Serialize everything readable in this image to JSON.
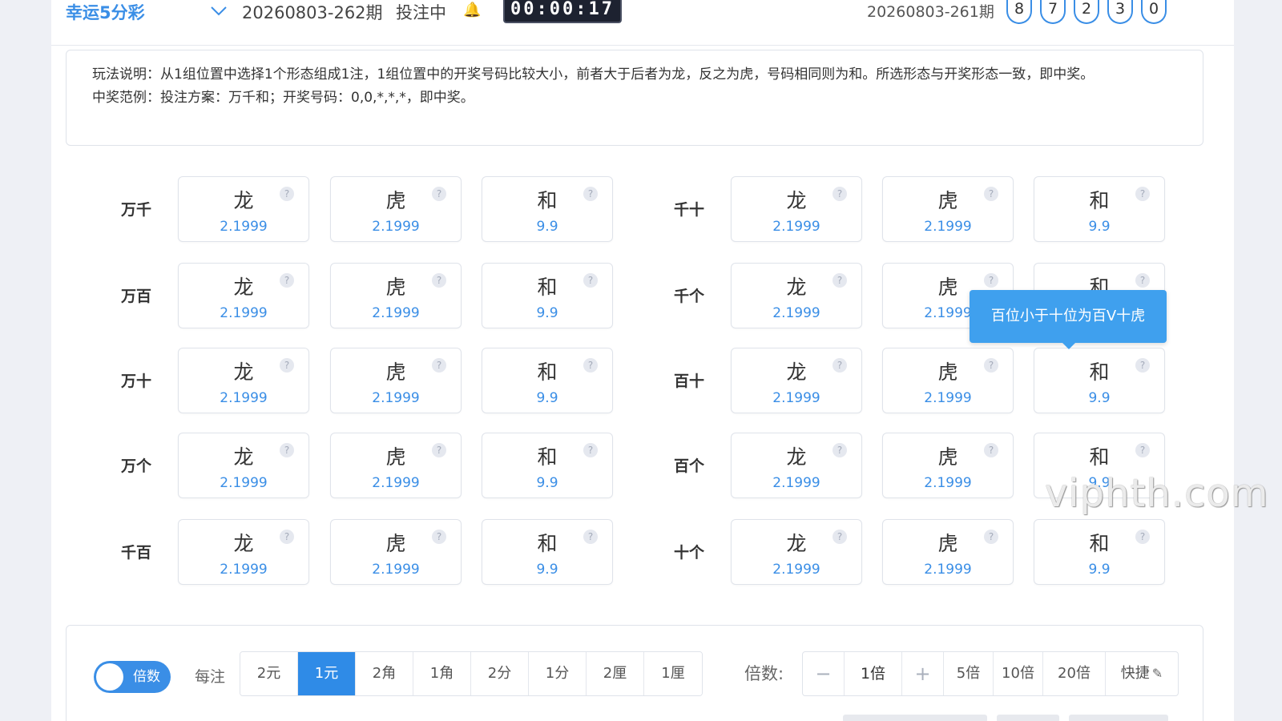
{
  "header": {
    "game_name": "幸运5分彩",
    "current_period": "20260803-262期",
    "status": "投注中",
    "countdown": "00:00:17",
    "last_period": "20260803-261期",
    "last_numbers": [
      "8",
      "7",
      "2",
      "3",
      "0"
    ]
  },
  "description": {
    "rule": "玩法说明：从1组位置中选择1个形态组成1注，1组位置中的开奖号码比较大小，前者大于后者为龙，反之为虎，号码相同则为和。所选形态与开奖形态一致，即中奖。",
    "example": "中奖范例：投注方案：万千和；开奖号码：0,0,*,*,*，即中奖。"
  },
  "options": [
    {
      "name": "龙",
      "odds": "2.1999"
    },
    {
      "name": "虎",
      "odds": "2.1999"
    },
    {
      "name": "和",
      "odds": "9.9"
    }
  ],
  "left_groups": [
    "万千",
    "万百",
    "万十",
    "万个",
    "千百"
  ],
  "right_groups": [
    "千十",
    "千个",
    "百十",
    "百个",
    "十个"
  ],
  "help_mark": "?",
  "tooltip": "百位小于十位为百V十虎",
  "bottom": {
    "toggle_label": "倍数",
    "per_bet_label": "每注",
    "units": [
      "2元",
      "1元",
      "2角",
      "1角",
      "2分",
      "1分",
      "2厘",
      "1厘"
    ],
    "active_unit": "1元",
    "multiplier_label": "倍数:",
    "minus": "−",
    "multiplier_value": "1倍",
    "plus": "+",
    "quick_multipliers": [
      "5倍",
      "10倍",
      "20倍"
    ],
    "quick_label": "快捷"
  },
  "watermark": "viphth.com"
}
